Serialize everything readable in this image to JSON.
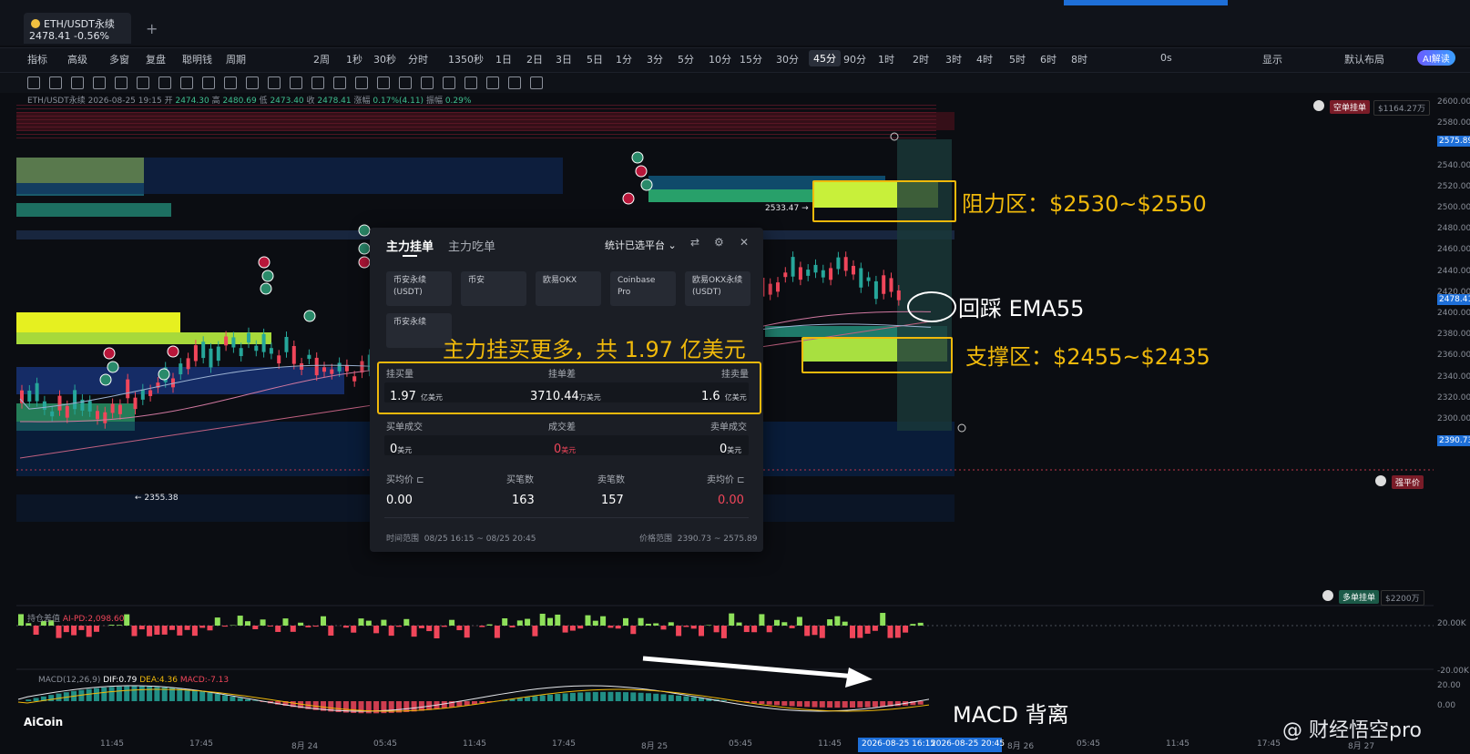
{
  "tab": {
    "symbol": "ETH/USDT永续",
    "price": "2478.41",
    "change": "-0.56%"
  },
  "toolbar": {
    "items": [
      "指标",
      "高级",
      "多窗",
      "复盘",
      "聪明钱",
      "周期",
      "2周",
      "1秒",
      "30秒",
      "分时",
      "1350秒",
      "1日",
      "2日",
      "3日",
      "5日",
      "1分",
      "3分",
      "5分",
      "10分",
      "15分",
      "30分",
      "45分",
      "90分",
      "1时",
      "2时",
      "3时",
      "4时",
      "5时",
      "6时",
      "8时",
      "0s",
      "显示",
      "默认布局",
      "AI解读"
    ],
    "selected": "45分"
  },
  "info_line": {
    "symbol": "ETH/USDT永续",
    "time": "2026-08-25 19:15",
    "open_l": "开",
    "open": "2474.30",
    "high_l": "高",
    "high": "2480.69",
    "low_l": "低",
    "low": "2473.40",
    "close_l": "收",
    "close": "2478.41",
    "chg_l": "涨幅",
    "chg": "0.17%(4.11)",
    "amp_l": "振幅",
    "amp": "0.29%"
  },
  "yaxis": {
    "ticks": [
      "2600.00",
      "2580.00",
      "2560.00",
      "2540.00",
      "2520.00",
      "2500.00",
      "2480.00",
      "2460.00",
      "2440.00",
      "2420.00",
      "2400.00",
      "2380.00",
      "2360.00",
      "2340.00",
      "2320.00",
      "2300.00"
    ],
    "label_high": "2575.89",
    "label_last": "2478.41",
    "label_low": "2390.73",
    "sub_ticks": [
      "20.00K",
      "-20.00K",
      "20.00",
      "0.00"
    ]
  },
  "xaxis": {
    "ticks": [
      "11:45",
      "17:45",
      "8月 24",
      "05:45",
      "11:45",
      "17:45",
      "8月 25",
      "05:45",
      "11:45",
      "8月 26",
      "05:45",
      "11:45",
      "17:45",
      "8月 27"
    ],
    "highlight_left": "2026-08-25 16:15",
    "highlight_right": "2026-08-25 20:45"
  },
  "tags": {
    "ask": "空单挂单",
    "ask_val": "$1164.27万",
    "bid": "多单挂单",
    "bid_val": "$2200万",
    "liq": "强平价"
  },
  "price_marks": {
    "high": "2533.47",
    "low": "2355.38"
  },
  "annotations": {
    "resist": "阻力区：$2530~$2550",
    "ema": "回踩 EMA55",
    "support": "支撑区：$2455~$2435",
    "main": "主力挂买更多，共 1.97 亿美元",
    "macd": "MACD 背离"
  },
  "panel": {
    "tab_active": "主力挂单",
    "tab_inactive": "主力吃单",
    "platform": "统计已选平台",
    "exchanges": [
      "币安永续(USDT)",
      "币安",
      "欧易OKX",
      "Coinbase Pro",
      "欧易OKX永续(USDT)",
      "币安永续"
    ],
    "buy_label": "挂买量",
    "diff_label": "挂单差",
    "sell_label": "挂卖量",
    "buy_val": "1.97",
    "buy_unit": "亿美元",
    "diff_val": "3710.44",
    "diff_unit": "万美元",
    "sell_val": "1.6",
    "sell_unit": "亿美元",
    "tbuy_label": "买单成交",
    "tdiff_label": "成交差",
    "tsell_label": "卖单成交",
    "tbuy_val": "0",
    "tbuy_unit": "美元",
    "tdiff_val": "0",
    "tdiff_unit": "美元",
    "tsell_val": "0",
    "tsell_unit": "美元",
    "avg_buy_label": "买均价",
    "buy_cnt_label": "买笔数",
    "sell_cnt_label": "卖笔数",
    "avg_sell_label": "卖均价",
    "avg_buy": "0.00",
    "buy_cnt": "163",
    "sell_cnt": "157",
    "avg_sell": "0.00",
    "time_label": "时间范围",
    "time_val": "08/25 16:15 ~ 08/25 20:45",
    "price_label": "价格范围",
    "price_val": "2390.73 ~ 2575.89"
  },
  "sub1": {
    "title": "持仓差值",
    "ind": "AI-PD:2,098.60"
  },
  "sub2": {
    "title": "MACD(12,26,9)",
    "dif": "DIF:0.79",
    "dea": "DEA:4.36",
    "macd": "MACD:-7.13"
  },
  "brand": "AiCoin",
  "watermark": "@ 财经悟空pro",
  "colors": {
    "accent": "#f0b90b",
    "up": "#26a69a",
    "down": "#f0465a",
    "select_blue": "#1e6fd8"
  }
}
